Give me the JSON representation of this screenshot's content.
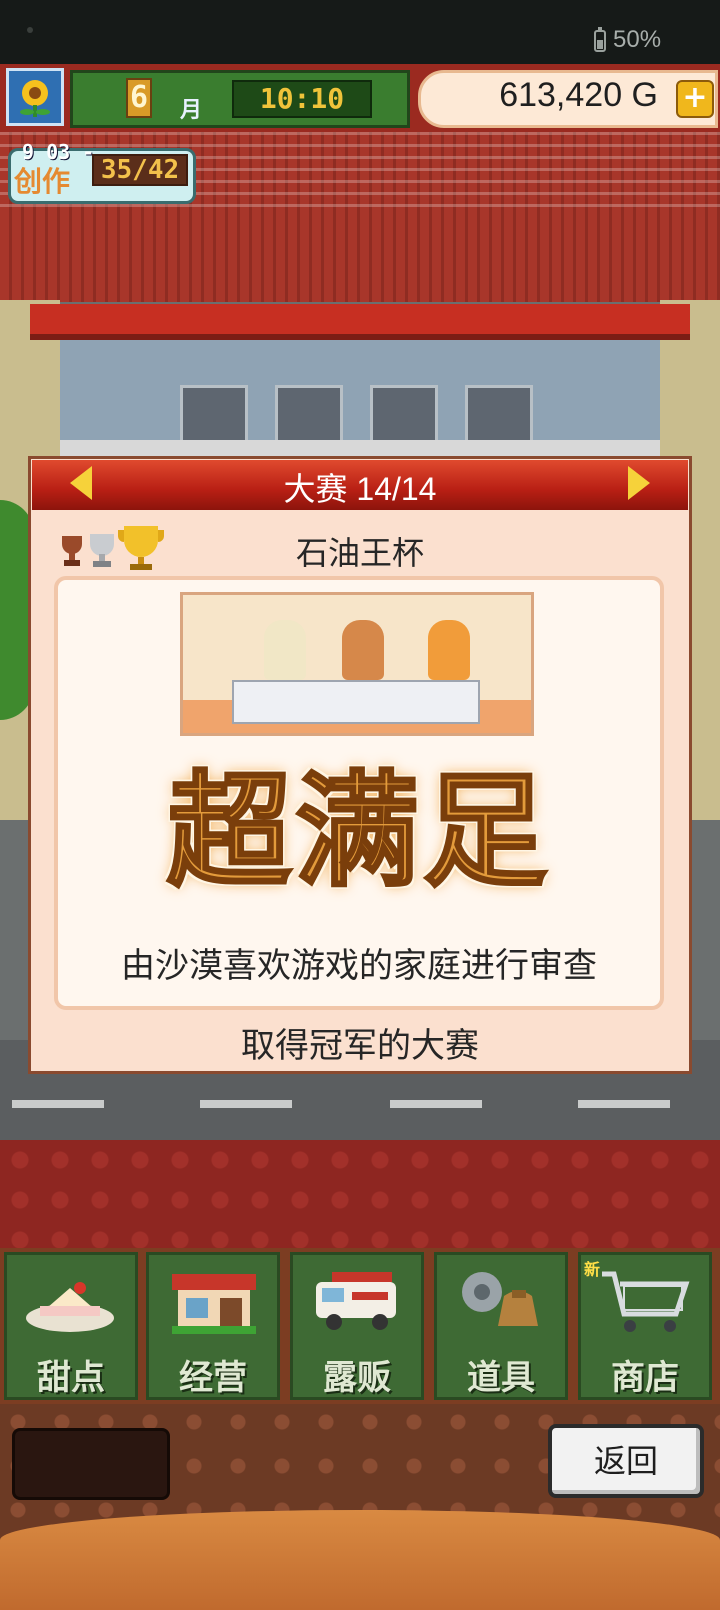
{
  "status_bar": {
    "battery": "50%",
    "battery_icon": "battery-icon"
  },
  "hud": {
    "month_number": "6",
    "month_label": "月",
    "clock": "10:10",
    "money": "613,420 G",
    "add_money_label": "+"
  },
  "creation": {
    "top_counter": "9 03 -",
    "label": "创作",
    "count": "35/42"
  },
  "contest": {
    "header_title": "大赛 14/14",
    "cup_name": "石油王杯",
    "result": "超满足",
    "judge_description": "由沙漠喜欢游戏的家庭进行审查",
    "footer": "取得冠军的大赛",
    "trophies": [
      "bronze-trophy-icon",
      "silver-trophy-icon",
      "gold-trophy-icon"
    ]
  },
  "menu": {
    "items": [
      {
        "label": "甜点",
        "icon": "cake-icon"
      },
      {
        "label": "经营",
        "icon": "shop-icon"
      },
      {
        "label": "露贩",
        "icon": "food-truck-icon"
      },
      {
        "label": "道具",
        "icon": "items-icon"
      },
      {
        "label": "商店",
        "icon": "cart-icon"
      }
    ],
    "new_badge": "新"
  },
  "back_button": "返回",
  "colors": {
    "header_red": "#b81f14",
    "dialog_bg": "#fbe0cf",
    "menu_green": "#3e6a34",
    "gold": "#f6d23a"
  }
}
